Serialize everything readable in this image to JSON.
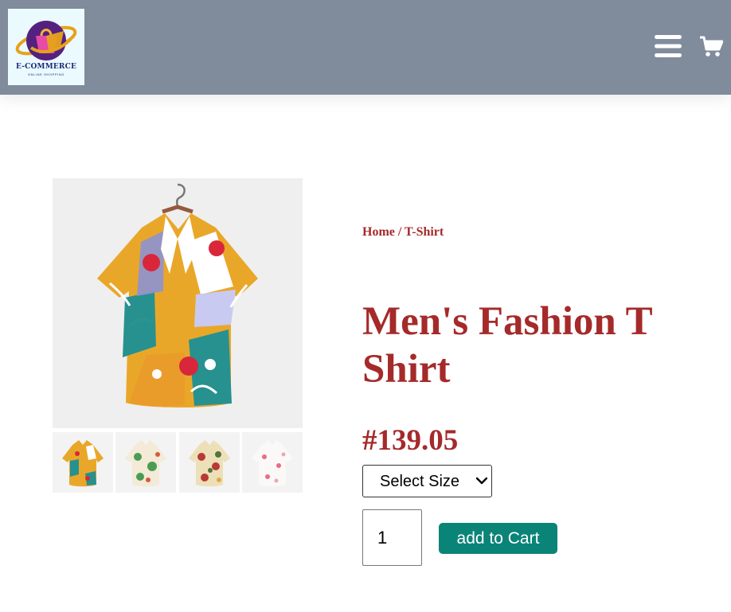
{
  "header": {
    "logo": {
      "text": "E-COMMERCE",
      "subtext": "ONLINE SHOPPING"
    },
    "icons": [
      "menu-icon",
      "cart-icon"
    ]
  },
  "breadcrumb": {
    "home": "Home",
    "separator": " / ",
    "current": "T-Shirt"
  },
  "product": {
    "title": "Men's Fashion T Shirt",
    "price": "#139.05",
    "size_select": "Select Size",
    "quantity": "1",
    "add_to_cart": "add to Cart"
  },
  "gallery": {
    "thumbnails": 4
  },
  "colors": {
    "header_bg": "#808b9c",
    "accent": "#a52a2a",
    "button": "#0b8478"
  }
}
